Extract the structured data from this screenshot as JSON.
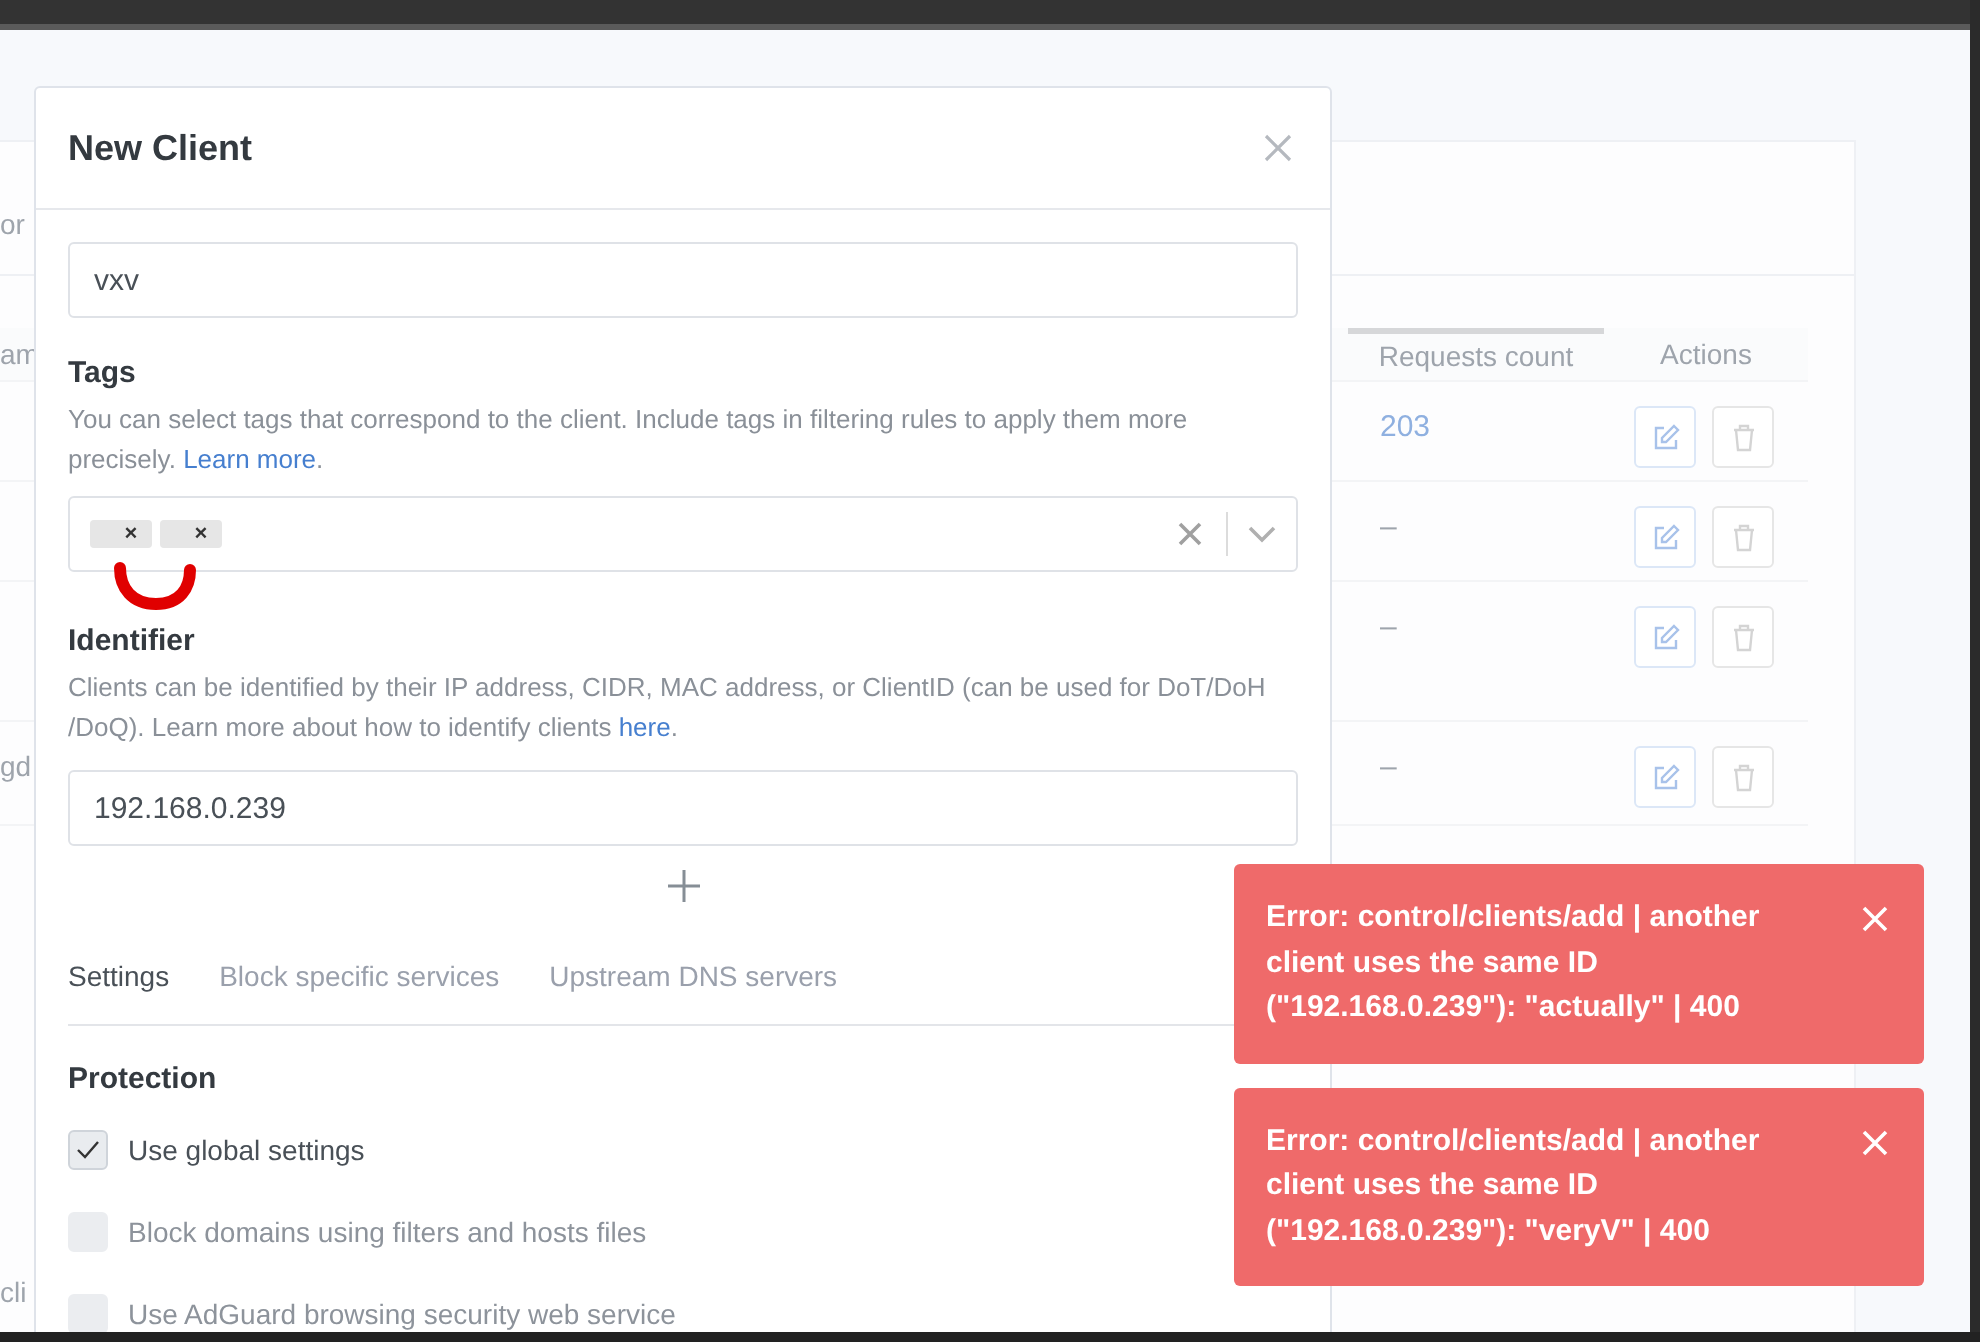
{
  "backdrop": {
    "search_fragment": "or",
    "columns": [
      {
        "label": "am"
      },
      {
        "label": "Requests count",
        "sorted": true
      },
      {
        "label": "Actions",
        "sorted": false
      }
    ],
    "rows": [
      {
        "requests": "203"
      },
      {
        "requests": "–"
      },
      {
        "requests": "–"
      },
      {
        "name": "gd",
        "requests": "–"
      }
    ],
    "footer_fragment": "cli"
  },
  "modal": {
    "title": "New Client",
    "name_value": "vxv",
    "tags": {
      "label": "Tags",
      "description": "You can select tags that correspond to the client. Include tags in filtering rules to apply them more precisely.",
      "link": "Learn more",
      "link_suffix": ".",
      "chips": [
        {
          "remove": "×"
        },
        {
          "remove": "×"
        }
      ]
    },
    "identifier": {
      "label": "Identifier",
      "description": "Clients can be identified by their IP address, CIDR, MAC address, or ClientID (can be used for DoT/DoH /DoQ). Learn more about how to identify clients",
      "link": "here",
      "link_suffix": ".",
      "value": "192.168.0.239"
    },
    "tabs": [
      {
        "label": "Settings",
        "selected": true
      },
      {
        "label": "Block specific services",
        "selected": false
      },
      {
        "label": "Upstream DNS servers",
        "selected": false
      }
    ],
    "section": "Protection",
    "options": [
      {
        "label": "Use global settings",
        "checked": true,
        "disabled": false
      },
      {
        "label": "Block domains using filters and hosts files",
        "checked": false,
        "disabled": true
      },
      {
        "label": "Use AdGuard browsing security web service",
        "checked": false,
        "disabled": true
      }
    ]
  },
  "toasts": [
    {
      "message": "Error: control/clients/add | another client uses the same ID (\"192.168.0.239\"): \"actually\" | 400"
    },
    {
      "message": "Error: control/clients/add | another client uses the same ID (\"192.168.0.239\"): \"veryV\" | 400"
    }
  ]
}
